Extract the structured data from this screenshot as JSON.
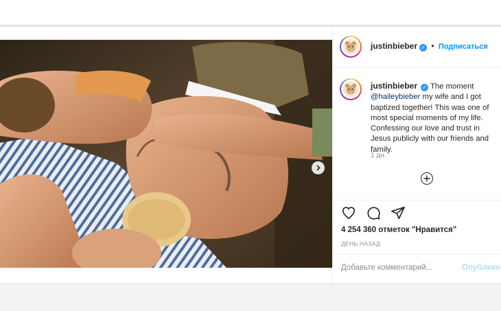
{
  "post": {
    "author": {
      "username": "justinbieber",
      "verified": true,
      "avatar_icon": "bear-avatar-icon"
    },
    "header": {
      "separator": "•",
      "follow_label": "Подписаться"
    },
    "caption": {
      "username": "justinbieber",
      "text_before_mention": "The moment ",
      "mention": "@haileybieber",
      "text_after_mention": " my wife and I got baptized together! This was one of most special moments of my life. Confessing our love and trust in Jesus publicly with our friends and family."
    },
    "time_ago": "1 дн.",
    "likes_text": "4 254 360 отметок \"Нравится\"",
    "posted_label": "ДЕНЬ НАЗАД",
    "comment": {
      "placeholder": "Добавьте комментарий...",
      "publish_label": "Опубликовать"
    },
    "carousel": {
      "slides_total": 4,
      "active_index": 0
    },
    "colors": {
      "accent": "#0095f6",
      "verified": "#3897f0",
      "publish_disabled": "#b2dffc",
      "muted": "#8e8e8e"
    }
  }
}
